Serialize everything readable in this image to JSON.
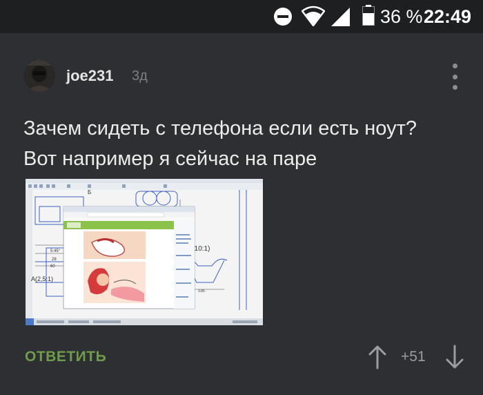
{
  "status_bar": {
    "icons": [
      "do-not-disturb-icon",
      "wifi-icon",
      "cellular-signal-icon",
      "battery-icon"
    ],
    "battery_percent": "36 %",
    "time": "22:49"
  },
  "comment": {
    "author": "joe231",
    "time_ago": "3д",
    "text_lines": [
      "Зачем сидеть с телефона если есть ноут?",
      "Вот например я сейчас на паре"
    ],
    "attachment_icon": "screenshot-image"
  },
  "actions": {
    "reply_label": "ОТВЕТИТЬ",
    "score": "+51",
    "upvote_icon": "arrow-up-icon",
    "downvote_icon": "arrow-down-icon",
    "menu_icon": "more-vertical-icon"
  },
  "colors": {
    "background": "#2d2f32",
    "status_bar": "#1e1f21",
    "reply_green": "#6f9b4a",
    "muted": "#7c7f83"
  }
}
